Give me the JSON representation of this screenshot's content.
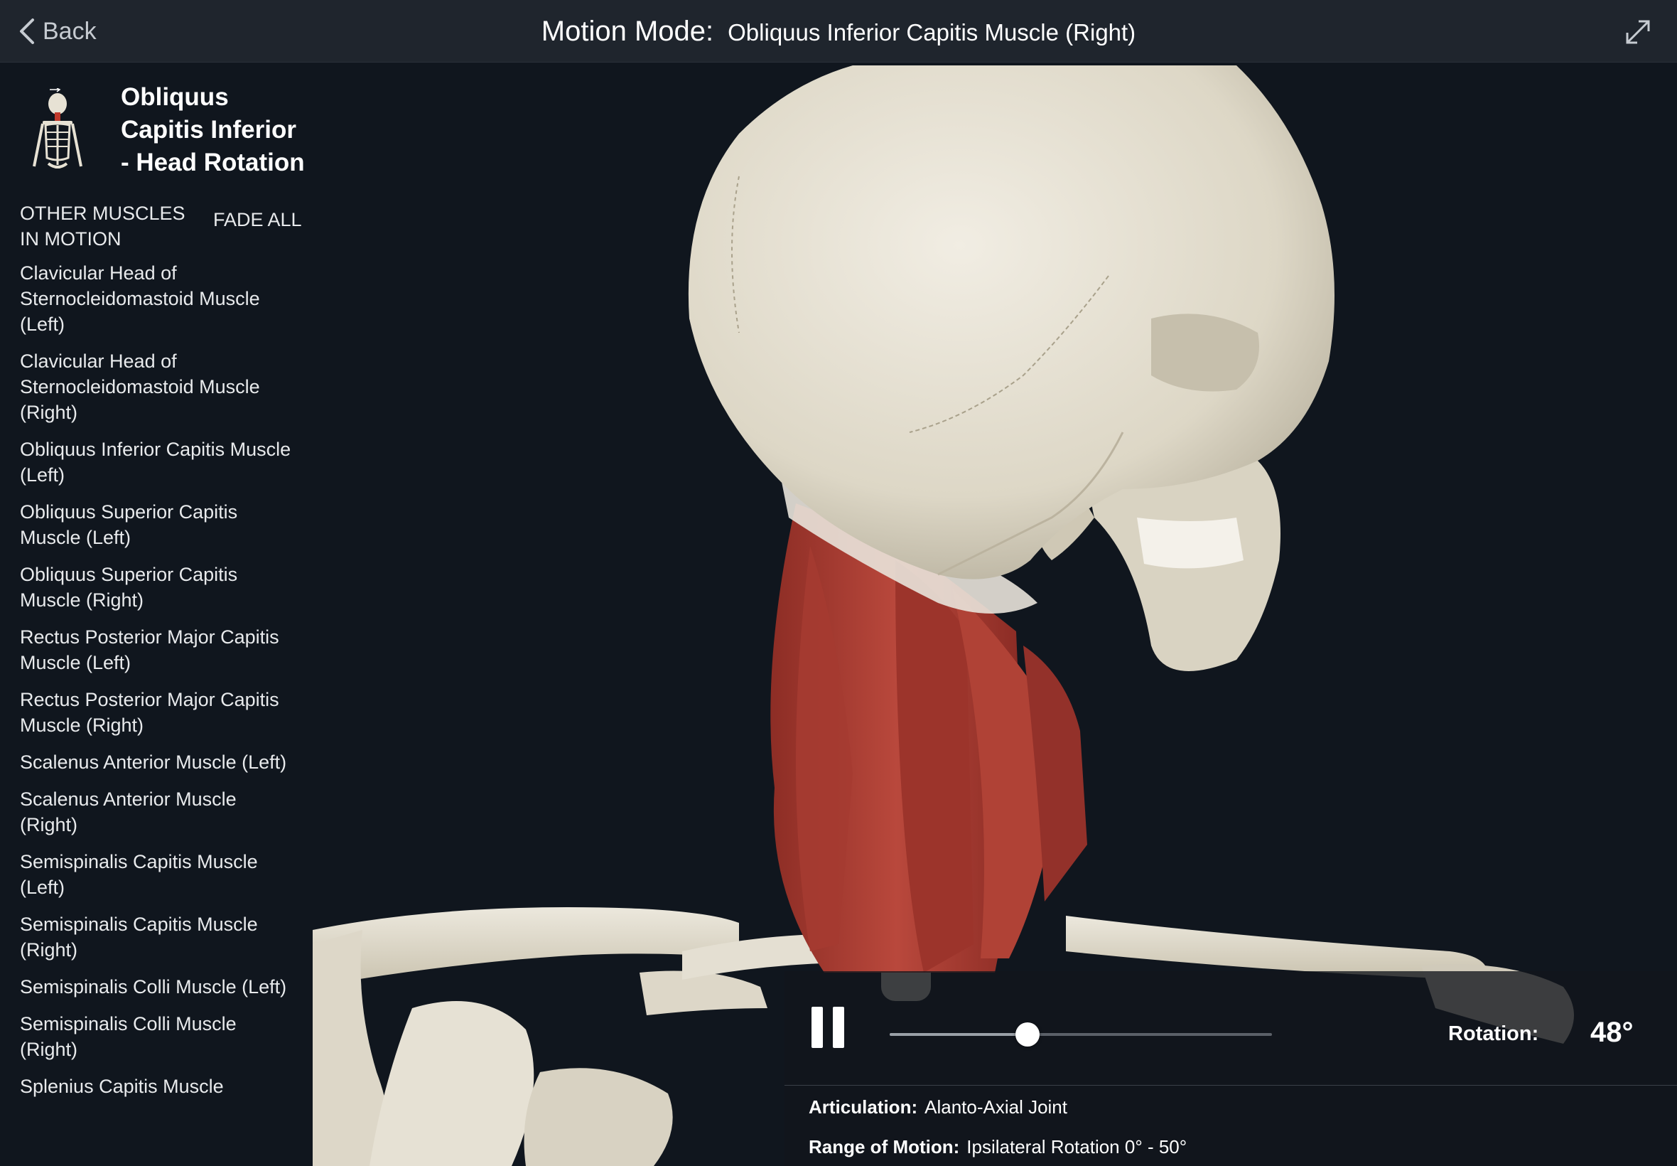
{
  "header": {
    "back_label": "Back",
    "mode_label": "Motion Mode:",
    "muscle_name": "Obliquus Inferior Capitis Muscle (Right)"
  },
  "sidebar": {
    "motion_title": "Obliquus Capitis Inferior - Head Rotation",
    "other_muscles_header": "OTHER MUSCLES IN MOTION",
    "fade_all_label": "FADE ALL",
    "muscles": [
      "Clavicular Head of Sternocleidomastoid Muscle (Left)",
      "Clavicular Head of Sternocleidomastoid Muscle (Right)",
      "Obliquus Inferior Capitis Muscle (Left)",
      "Obliquus Superior Capitis Muscle (Left)",
      "Obliquus Superior Capitis Muscle (Right)",
      "Rectus Posterior Major Capitis Muscle (Left)",
      "Rectus Posterior Major Capitis Muscle (Right)",
      "Scalenus Anterior Muscle (Left)",
      "Scalenus Anterior Muscle (Right)",
      "Semispinalis Capitis Muscle (Left)",
      "Semispinalis Capitis Muscle (Right)",
      "Semispinalis Colli Muscle (Left)",
      "Semispinalis Colli Muscle (Right)",
      "Splenius Capitis Muscle"
    ]
  },
  "controls": {
    "rotation_label": "Rotation:",
    "rotation_value": "48°",
    "slider_fraction": 0.36,
    "articulation_label": "Articulation:",
    "articulation_value": "Alanto-Axial Joint",
    "range_label": "Range of Motion:",
    "range_value": "Ipsilateral Rotation 0° - 50°"
  },
  "icons": {
    "back": "chevron-left-icon",
    "expand": "expand-icon",
    "pause": "pause-icon"
  },
  "colors": {
    "topbar": "#1f252d",
    "background": "#10161e",
    "bone": "#e7e2d4",
    "muscle": "#a83a30"
  }
}
